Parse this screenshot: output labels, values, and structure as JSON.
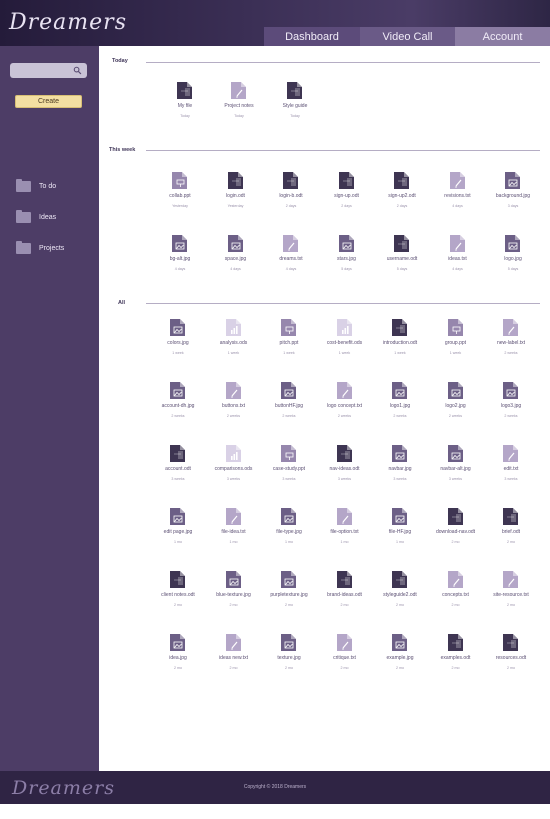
{
  "app": {
    "logo": "Dreamers"
  },
  "nav": {
    "tabs": [
      "Dashboard",
      "Video Call",
      "Account"
    ]
  },
  "sidebar": {
    "search_placeholder": "",
    "create_label": "Create",
    "items": [
      {
        "label": "To do"
      },
      {
        "label": "Ideas"
      },
      {
        "label": "Projects"
      }
    ]
  },
  "sections": {
    "today": "Today",
    "week": "This week",
    "all": "All"
  },
  "files_today": [
    {
      "name": "My file",
      "date": "Today",
      "kind": "doc"
    },
    {
      "name": "Project notes",
      "date": "Today",
      "kind": "txt"
    },
    {
      "name": "Style guide",
      "date": "Today",
      "kind": "doc"
    }
  ],
  "files_week": [
    {
      "name": "collab.ppt",
      "date": "Yesterday",
      "kind": "ppt"
    },
    {
      "name": "login.odt",
      "date": "Yesterday",
      "kind": "doc"
    },
    {
      "name": "login-b.odt",
      "date": "2 days",
      "kind": "doc"
    },
    {
      "name": "sign-up.odt",
      "date": "2 days",
      "kind": "doc"
    },
    {
      "name": "sign-up2.odt",
      "date": "2 days",
      "kind": "doc"
    },
    {
      "name": "revisions.txt",
      "date": "4 days",
      "kind": "txt"
    },
    {
      "name": "background.jpg",
      "date": "3 days",
      "kind": "img"
    },
    {
      "name": "bg-alt.jpg",
      "date": "4 days",
      "kind": "img"
    },
    {
      "name": "space.jpg",
      "date": "4 days",
      "kind": "img"
    },
    {
      "name": "dreams.txt",
      "date": "4 days",
      "kind": "txt"
    },
    {
      "name": "stars.jpg",
      "date": "5 days",
      "kind": "img"
    },
    {
      "name": "username.odt",
      "date": "5 days",
      "kind": "doc"
    },
    {
      "name": "ideas.txt",
      "date": "4 days",
      "kind": "txt"
    },
    {
      "name": "logo.jpg",
      "date": "5 days",
      "kind": "img"
    }
  ],
  "files_all": [
    {
      "name": "colors.jpg",
      "date": "1 week",
      "kind": "img"
    },
    {
      "name": "analysis.ods",
      "date": "1 week",
      "kind": "ods"
    },
    {
      "name": "pitch.ppt",
      "date": "1 week",
      "kind": "ppt"
    },
    {
      "name": "cost-benefit.ods",
      "date": "1 week",
      "kind": "ods"
    },
    {
      "name": "introduction.odt",
      "date": "1 week",
      "kind": "doc"
    },
    {
      "name": "group.ppt",
      "date": "1 week",
      "kind": "ppt"
    },
    {
      "name": "new-label.txt",
      "date": "2 weeks",
      "kind": "txt"
    },
    {
      "name": "account-dh.jpg",
      "date": "2 weeks",
      "kind": "img"
    },
    {
      "name": "buttons.txt",
      "date": "2 weeks",
      "kind": "txt"
    },
    {
      "name": "buttonHF.jpg",
      "date": "2 weeks",
      "kind": "img"
    },
    {
      "name": "logo concept.txt",
      "date": "2 weeks",
      "kind": "txt"
    },
    {
      "name": "logo1.jpg",
      "date": "2 weeks",
      "kind": "img"
    },
    {
      "name": "logo2.jpg",
      "date": "2 weeks",
      "kind": "img"
    },
    {
      "name": "logo3.jpg",
      "date": "2 weeks",
      "kind": "img"
    },
    {
      "name": "account.odt",
      "date": "3 weeks",
      "kind": "doc"
    },
    {
      "name": "comparisons.ods",
      "date": "3 weeks",
      "kind": "ods"
    },
    {
      "name": "case-study.ppt",
      "date": "3 weeks",
      "kind": "ppt"
    },
    {
      "name": "nav-ideas.odt",
      "date": "3 weeks",
      "kind": "doc"
    },
    {
      "name": "navbar.jpg",
      "date": "3 weeks",
      "kind": "img"
    },
    {
      "name": "navbar-alt.jpg",
      "date": "3 weeks",
      "kind": "img"
    },
    {
      "name": "edit.txt",
      "date": "3 weeks",
      "kind": "txt"
    },
    {
      "name": "edit page.jpg",
      "date": "1 mo",
      "kind": "img"
    },
    {
      "name": "file-idea.txt",
      "date": "1 mo",
      "kind": "txt"
    },
    {
      "name": "file-type.jpg",
      "date": "1 mo",
      "kind": "img"
    },
    {
      "name": "file-option.txt",
      "date": "1 mo",
      "kind": "txt"
    },
    {
      "name": "file-HF.jpg",
      "date": "1 mo",
      "kind": "img"
    },
    {
      "name": "download-nav.odt",
      "date": "2 mo",
      "kind": "doc"
    },
    {
      "name": "brief.odt",
      "date": "2 mo",
      "kind": "doc"
    },
    {
      "name": "client notes.odt",
      "date": "2 mo",
      "kind": "doc"
    },
    {
      "name": "blue-texture.jpg",
      "date": "2 mo",
      "kind": "img"
    },
    {
      "name": "purpletexture.jpg",
      "date": "2 mo",
      "kind": "img"
    },
    {
      "name": "brand-ideas.odt",
      "date": "2 mo",
      "kind": "doc"
    },
    {
      "name": "styleguide2.odt",
      "date": "2 mo",
      "kind": "doc"
    },
    {
      "name": "concepts.txt",
      "date": "2 mo",
      "kind": "txt"
    },
    {
      "name": "site-resource.txt",
      "date": "2 mo",
      "kind": "txt"
    },
    {
      "name": "idea.jpg",
      "date": "2 mo",
      "kind": "img"
    },
    {
      "name": "ideas new.txt",
      "date": "2 mo",
      "kind": "txt"
    },
    {
      "name": "texture.jpg",
      "date": "2 mo",
      "kind": "img"
    },
    {
      "name": "critique.txt",
      "date": "2 mo",
      "kind": "txt"
    },
    {
      "name": "example.jpg",
      "date": "2 mo",
      "kind": "img"
    },
    {
      "name": "examples.odt",
      "date": "2 mo",
      "kind": "doc"
    },
    {
      "name": "resources.odt",
      "date": "2 mo",
      "kind": "doc"
    }
  ],
  "icon_colors": {
    "doc": "#3e3552",
    "img": "#6c5f86",
    "txt": "#b4a6c8",
    "ppt": "#9687ad",
    "ods": "#d9d1e6"
  },
  "footer": {
    "logo": "Dreamers",
    "copyright": "Copyright © 2018 Dreamers"
  }
}
